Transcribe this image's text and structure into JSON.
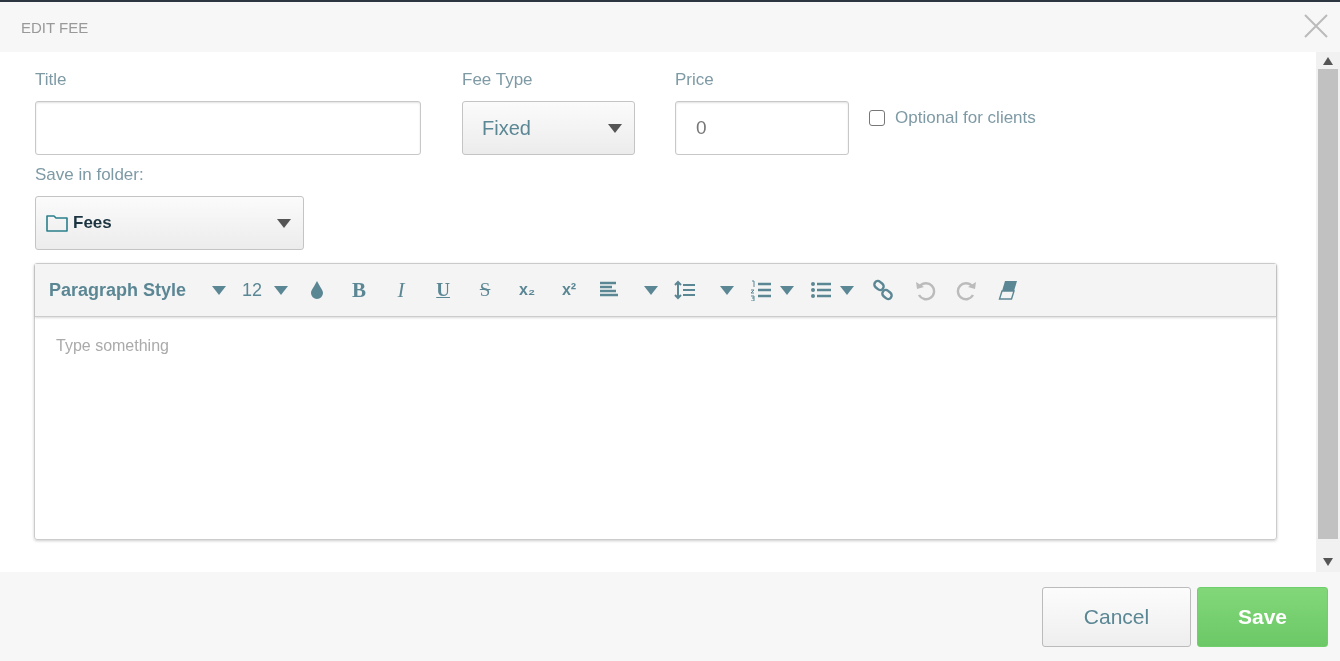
{
  "dialog": {
    "title": "EDIT FEE"
  },
  "fields": {
    "title": {
      "label": "Title"
    },
    "fee_type": {
      "label": "Fee Type",
      "value": "Fixed"
    },
    "price": {
      "label": "Price",
      "placeholder": "0"
    },
    "optional": {
      "label": "Optional for clients",
      "checked": false
    },
    "folder": {
      "label": "Save in folder:",
      "value": "Fees"
    }
  },
  "editor": {
    "placeholder": "Type something",
    "tools": [
      {
        "kind": "dropdown",
        "label": "Paragraph Style",
        "disabled": false
      },
      {
        "kind": "dropdown",
        "label": "12",
        "disabled": false
      },
      {
        "kind": "drop",
        "disabled": false
      },
      {
        "kind": "bold",
        "label": "B",
        "disabled": false
      },
      {
        "kind": "italic",
        "label": "I",
        "disabled": false
      },
      {
        "kind": "underline",
        "label": "U",
        "disabled": false
      },
      {
        "kind": "strike",
        "label": "S",
        "disabled": false
      },
      {
        "kind": "subscript",
        "label": "x₂",
        "disabled": false
      },
      {
        "kind": "superscript",
        "label": "x²",
        "disabled": false
      },
      {
        "kind": "align",
        "disabled": false
      },
      {
        "kind": "line-height",
        "disabled": false
      },
      {
        "kind": "ordered-list",
        "disabled": false
      },
      {
        "kind": "bullet-list",
        "disabled": false
      },
      {
        "kind": "link",
        "disabled": false
      },
      {
        "kind": "undo",
        "disabled": true
      },
      {
        "kind": "redo",
        "disabled": true
      },
      {
        "kind": "eraser",
        "disabled": false
      }
    ]
  },
  "buttons": [
    {
      "kind": "cancel",
      "label": "Cancel"
    },
    {
      "kind": "save",
      "label": "Save"
    }
  ]
}
